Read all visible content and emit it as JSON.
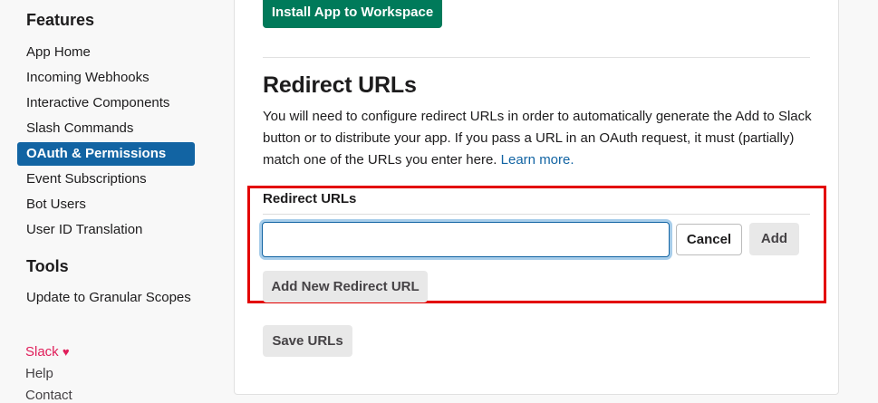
{
  "sidebar": {
    "features_title": "Features",
    "features": [
      {
        "label": "App Home"
      },
      {
        "label": "Incoming Webhooks"
      },
      {
        "label": "Interactive Components"
      },
      {
        "label": "Slash Commands"
      },
      {
        "label": "OAuth & Permissions",
        "active": true
      },
      {
        "label": "Event Subscriptions"
      },
      {
        "label": "Bot Users"
      },
      {
        "label": "User ID Translation"
      }
    ],
    "tools_title": "Tools",
    "tools": [
      {
        "label": "Update to Granular Scopes"
      }
    ],
    "footer": {
      "brand": "Slack",
      "heart_icon": "heart-icon",
      "help": "Help",
      "contact": "Contact"
    }
  },
  "main": {
    "install_button": "Install App to Workspace",
    "section_title": "Redirect URLs",
    "description": "You will need to configure redirect URLs in order to automatically generate the Add to Slack button or to distribute your app. If you pass a URL in an OAuth request, it must (partially) match one of the URLs you enter here.",
    "learn_more": "Learn more.",
    "field_label": "Redirect URLs",
    "url_input": {
      "value": "",
      "placeholder": ""
    },
    "cancel_button": "Cancel",
    "add_button": "Add",
    "add_new_button": "Add New Redirect URL",
    "save_button": "Save URLs"
  },
  "colors": {
    "accent": "#1264a3",
    "install_green": "#007a5a",
    "highlight_border": "#e30000",
    "brand_pink": "#e01e5a"
  }
}
